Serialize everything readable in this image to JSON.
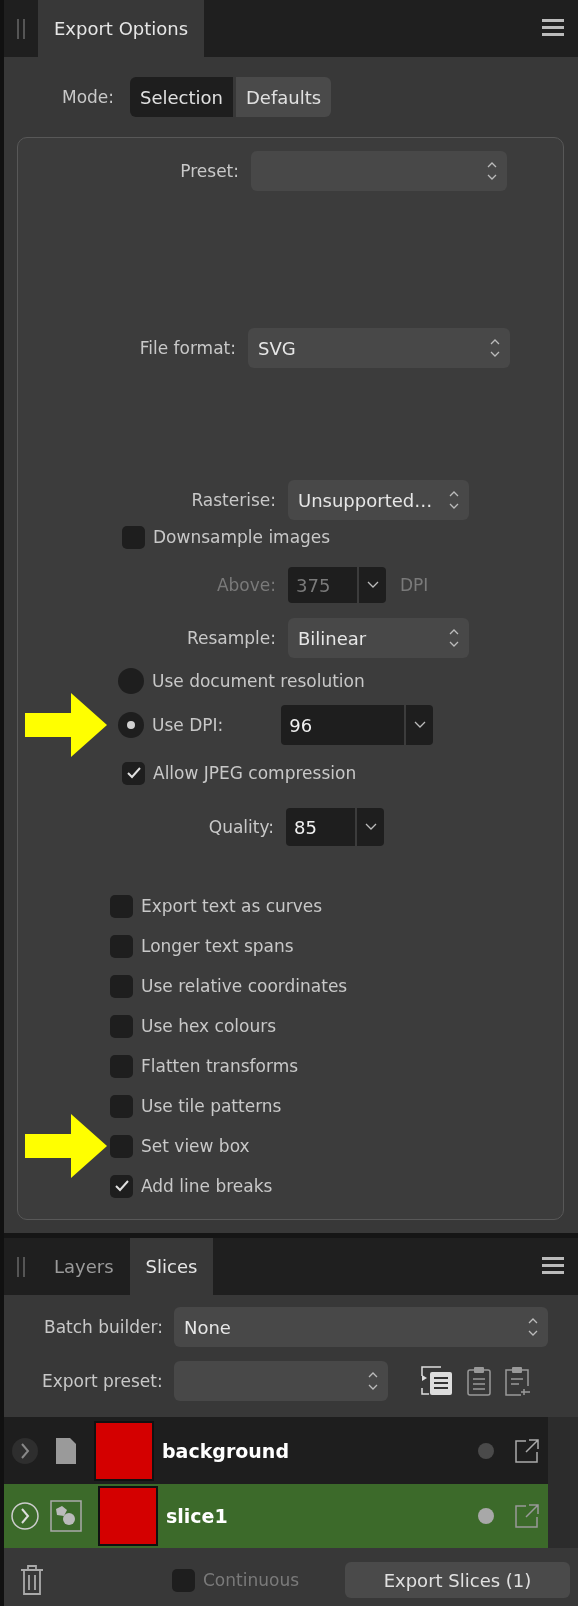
{
  "export_panel": {
    "tabs": [
      {
        "label": "Export Options",
        "selected": true
      }
    ],
    "mode": {
      "label": "Mode:",
      "options": [
        {
          "label": "Selection",
          "selected": true
        },
        {
          "label": "Defaults",
          "selected": false
        }
      ]
    },
    "preset": {
      "label": "Preset:"
    },
    "file_format": {
      "label": "File format:",
      "value": "SVG"
    },
    "rasterise": {
      "label": "Rasterise:",
      "value": "Unsupported…"
    },
    "downsample": {
      "label": "Downsample images",
      "checked": false
    },
    "above": {
      "label": "Above:",
      "value": "375",
      "unit": "DPI",
      "disabled": true
    },
    "resample": {
      "label": "Resample:",
      "value": "Bilinear"
    },
    "resolution_options": [
      {
        "label": "Use document resolution",
        "selected": false,
        "highlighted": false
      },
      {
        "label": "Use DPI:",
        "selected": true,
        "highlighted": true
      }
    ],
    "dpi": {
      "value": "96"
    },
    "jpeg": {
      "label": "Allow JPEG compression",
      "checked": true
    },
    "quality": {
      "label": "Quality:",
      "value": "85"
    },
    "svg_options": [
      {
        "label": "Export text as curves",
        "checked": false,
        "highlighted": false
      },
      {
        "label": "Longer text spans",
        "checked": false,
        "highlighted": false
      },
      {
        "label": "Use relative coordinates",
        "checked": false,
        "highlighted": false
      },
      {
        "label": "Use hex colours",
        "checked": false,
        "highlighted": false
      },
      {
        "label": "Flatten transforms",
        "checked": false,
        "highlighted": false
      },
      {
        "label": "Use tile patterns",
        "checked": false,
        "highlighted": false
      },
      {
        "label": "Set view box",
        "checked": false,
        "highlighted": true
      },
      {
        "label": "Add line breaks",
        "checked": true,
        "highlighted": false
      }
    ]
  },
  "slices_panel": {
    "tabs": [
      {
        "label": "Layers",
        "selected": false
      },
      {
        "label": "Slices",
        "selected": true
      }
    ],
    "batch_builder": {
      "label": "Batch builder:",
      "value": "None"
    },
    "export_preset": {
      "label": "Export preset:"
    },
    "slices": [
      {
        "name": "background",
        "kind": "document",
        "selected": false
      },
      {
        "name": "slice1",
        "kind": "slice",
        "selected": true
      }
    ],
    "continuous": {
      "label": "Continuous",
      "checked": false
    },
    "export_button": "Export Slices (1)"
  }
}
